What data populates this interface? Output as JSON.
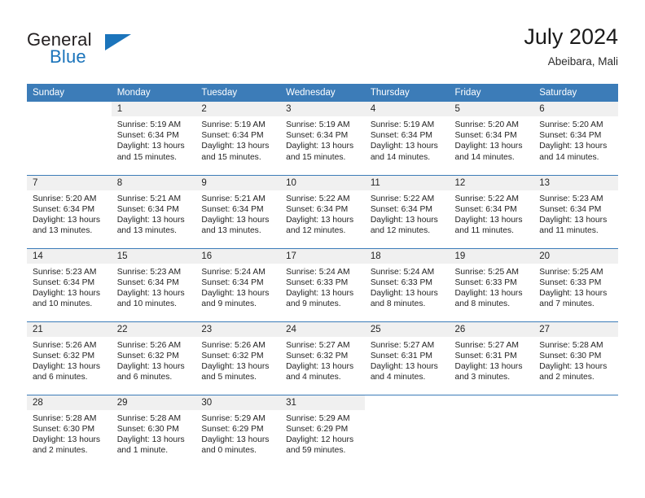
{
  "brand": {
    "name_part1": "General",
    "name_part2": "Blue"
  },
  "header": {
    "title": "July 2024",
    "subtitle": "Abeibara, Mali"
  },
  "colors": {
    "header_blue": "#3c7cb8",
    "brand_blue": "#1b74bb",
    "daynum_band": "#f0f0f0",
    "text": "#242424"
  },
  "weekday_headers": [
    "Sunday",
    "Monday",
    "Tuesday",
    "Wednesday",
    "Thursday",
    "Friday",
    "Saturday"
  ],
  "weeks": [
    [
      {
        "day": "",
        "sunrise": "",
        "sunset": "",
        "daylight_line1": "",
        "daylight_line2": ""
      },
      {
        "day": "1",
        "sunrise": "Sunrise: 5:19 AM",
        "sunset": "Sunset: 6:34 PM",
        "daylight_line1": "Daylight: 13 hours",
        "daylight_line2": "and 15 minutes."
      },
      {
        "day": "2",
        "sunrise": "Sunrise: 5:19 AM",
        "sunset": "Sunset: 6:34 PM",
        "daylight_line1": "Daylight: 13 hours",
        "daylight_line2": "and 15 minutes."
      },
      {
        "day": "3",
        "sunrise": "Sunrise: 5:19 AM",
        "sunset": "Sunset: 6:34 PM",
        "daylight_line1": "Daylight: 13 hours",
        "daylight_line2": "and 15 minutes."
      },
      {
        "day": "4",
        "sunrise": "Sunrise: 5:19 AM",
        "sunset": "Sunset: 6:34 PM",
        "daylight_line1": "Daylight: 13 hours",
        "daylight_line2": "and 14 minutes."
      },
      {
        "day": "5",
        "sunrise": "Sunrise: 5:20 AM",
        "sunset": "Sunset: 6:34 PM",
        "daylight_line1": "Daylight: 13 hours",
        "daylight_line2": "and 14 minutes."
      },
      {
        "day": "6",
        "sunrise": "Sunrise: 5:20 AM",
        "sunset": "Sunset: 6:34 PM",
        "daylight_line1": "Daylight: 13 hours",
        "daylight_line2": "and 14 minutes."
      }
    ],
    [
      {
        "day": "7",
        "sunrise": "Sunrise: 5:20 AM",
        "sunset": "Sunset: 6:34 PM",
        "daylight_line1": "Daylight: 13 hours",
        "daylight_line2": "and 13 minutes."
      },
      {
        "day": "8",
        "sunrise": "Sunrise: 5:21 AM",
        "sunset": "Sunset: 6:34 PM",
        "daylight_line1": "Daylight: 13 hours",
        "daylight_line2": "and 13 minutes."
      },
      {
        "day": "9",
        "sunrise": "Sunrise: 5:21 AM",
        "sunset": "Sunset: 6:34 PM",
        "daylight_line1": "Daylight: 13 hours",
        "daylight_line2": "and 13 minutes."
      },
      {
        "day": "10",
        "sunrise": "Sunrise: 5:22 AM",
        "sunset": "Sunset: 6:34 PM",
        "daylight_line1": "Daylight: 13 hours",
        "daylight_line2": "and 12 minutes."
      },
      {
        "day": "11",
        "sunrise": "Sunrise: 5:22 AM",
        "sunset": "Sunset: 6:34 PM",
        "daylight_line1": "Daylight: 13 hours",
        "daylight_line2": "and 12 minutes."
      },
      {
        "day": "12",
        "sunrise": "Sunrise: 5:22 AM",
        "sunset": "Sunset: 6:34 PM",
        "daylight_line1": "Daylight: 13 hours",
        "daylight_line2": "and 11 minutes."
      },
      {
        "day": "13",
        "sunrise": "Sunrise: 5:23 AM",
        "sunset": "Sunset: 6:34 PM",
        "daylight_line1": "Daylight: 13 hours",
        "daylight_line2": "and 11 minutes."
      }
    ],
    [
      {
        "day": "14",
        "sunrise": "Sunrise: 5:23 AM",
        "sunset": "Sunset: 6:34 PM",
        "daylight_line1": "Daylight: 13 hours",
        "daylight_line2": "and 10 minutes."
      },
      {
        "day": "15",
        "sunrise": "Sunrise: 5:23 AM",
        "sunset": "Sunset: 6:34 PM",
        "daylight_line1": "Daylight: 13 hours",
        "daylight_line2": "and 10 minutes."
      },
      {
        "day": "16",
        "sunrise": "Sunrise: 5:24 AM",
        "sunset": "Sunset: 6:34 PM",
        "daylight_line1": "Daylight: 13 hours",
        "daylight_line2": "and 9 minutes."
      },
      {
        "day": "17",
        "sunrise": "Sunrise: 5:24 AM",
        "sunset": "Sunset: 6:33 PM",
        "daylight_line1": "Daylight: 13 hours",
        "daylight_line2": "and 9 minutes."
      },
      {
        "day": "18",
        "sunrise": "Sunrise: 5:24 AM",
        "sunset": "Sunset: 6:33 PM",
        "daylight_line1": "Daylight: 13 hours",
        "daylight_line2": "and 8 minutes."
      },
      {
        "day": "19",
        "sunrise": "Sunrise: 5:25 AM",
        "sunset": "Sunset: 6:33 PM",
        "daylight_line1": "Daylight: 13 hours",
        "daylight_line2": "and 8 minutes."
      },
      {
        "day": "20",
        "sunrise": "Sunrise: 5:25 AM",
        "sunset": "Sunset: 6:33 PM",
        "daylight_line1": "Daylight: 13 hours",
        "daylight_line2": "and 7 minutes."
      }
    ],
    [
      {
        "day": "21",
        "sunrise": "Sunrise: 5:26 AM",
        "sunset": "Sunset: 6:32 PM",
        "daylight_line1": "Daylight: 13 hours",
        "daylight_line2": "and 6 minutes."
      },
      {
        "day": "22",
        "sunrise": "Sunrise: 5:26 AM",
        "sunset": "Sunset: 6:32 PM",
        "daylight_line1": "Daylight: 13 hours",
        "daylight_line2": "and 6 minutes."
      },
      {
        "day": "23",
        "sunrise": "Sunrise: 5:26 AM",
        "sunset": "Sunset: 6:32 PM",
        "daylight_line1": "Daylight: 13 hours",
        "daylight_line2": "and 5 minutes."
      },
      {
        "day": "24",
        "sunrise": "Sunrise: 5:27 AM",
        "sunset": "Sunset: 6:32 PM",
        "daylight_line1": "Daylight: 13 hours",
        "daylight_line2": "and 4 minutes."
      },
      {
        "day": "25",
        "sunrise": "Sunrise: 5:27 AM",
        "sunset": "Sunset: 6:31 PM",
        "daylight_line1": "Daylight: 13 hours",
        "daylight_line2": "and 4 minutes."
      },
      {
        "day": "26",
        "sunrise": "Sunrise: 5:27 AM",
        "sunset": "Sunset: 6:31 PM",
        "daylight_line1": "Daylight: 13 hours",
        "daylight_line2": "and 3 minutes."
      },
      {
        "day": "27",
        "sunrise": "Sunrise: 5:28 AM",
        "sunset": "Sunset: 6:30 PM",
        "daylight_line1": "Daylight: 13 hours",
        "daylight_line2": "and 2 minutes."
      }
    ],
    [
      {
        "day": "28",
        "sunrise": "Sunrise: 5:28 AM",
        "sunset": "Sunset: 6:30 PM",
        "daylight_line1": "Daylight: 13 hours",
        "daylight_line2": "and 2 minutes."
      },
      {
        "day": "29",
        "sunrise": "Sunrise: 5:28 AM",
        "sunset": "Sunset: 6:30 PM",
        "daylight_line1": "Daylight: 13 hours",
        "daylight_line2": "and 1 minute."
      },
      {
        "day": "30",
        "sunrise": "Sunrise: 5:29 AM",
        "sunset": "Sunset: 6:29 PM",
        "daylight_line1": "Daylight: 13 hours",
        "daylight_line2": "and 0 minutes."
      },
      {
        "day": "31",
        "sunrise": "Sunrise: 5:29 AM",
        "sunset": "Sunset: 6:29 PM",
        "daylight_line1": "Daylight: 12 hours",
        "daylight_line2": "and 59 minutes."
      },
      {
        "day": "",
        "sunrise": "",
        "sunset": "",
        "daylight_line1": "",
        "daylight_line2": ""
      },
      {
        "day": "",
        "sunrise": "",
        "sunset": "",
        "daylight_line1": "",
        "daylight_line2": ""
      },
      {
        "day": "",
        "sunrise": "",
        "sunset": "",
        "daylight_line1": "",
        "daylight_line2": ""
      }
    ]
  ]
}
